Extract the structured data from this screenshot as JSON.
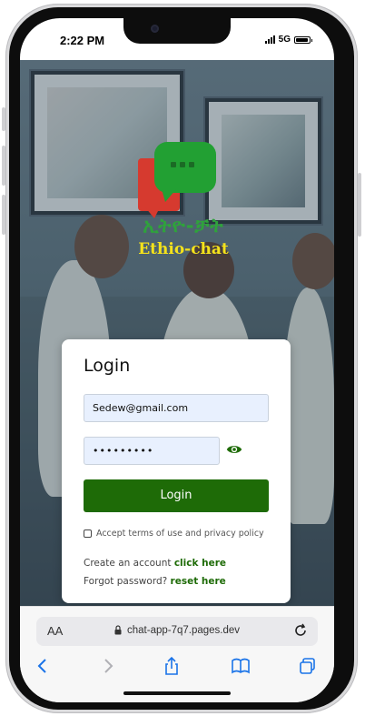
{
  "status_bar": {
    "time": "2:22 PM",
    "network": "5G",
    "battery_level": 0.9
  },
  "logo": {
    "amharic_text": "ኢትዮ-ቻት",
    "brand_text": "Ethio-chat"
  },
  "login_card": {
    "title": "Login",
    "email_value": "Sedew@gmail.com",
    "password_value": "•••••••••",
    "login_button": "Login",
    "terms_label": "Accept terms of use and privacy policy",
    "create_account_text": "Create an account",
    "create_account_link": "click here",
    "forgot_password_text": "Forgot password?",
    "forgot_password_link": "reset here"
  },
  "browser": {
    "text_size_label": "AA",
    "url": "chat-app-7q7.pages.dev"
  },
  "icons": [
    "eye-icon",
    "lock-icon",
    "reload-icon",
    "back-icon",
    "forward-icon",
    "share-icon",
    "bookmarks-icon",
    "tabs-icon",
    "chat-bubble-icon"
  ],
  "colors": {
    "accent_green": "#1e6b07",
    "logo_green": "#22a033",
    "logo_red": "#d63a2f",
    "brand_yellow": "#f4e21b"
  }
}
